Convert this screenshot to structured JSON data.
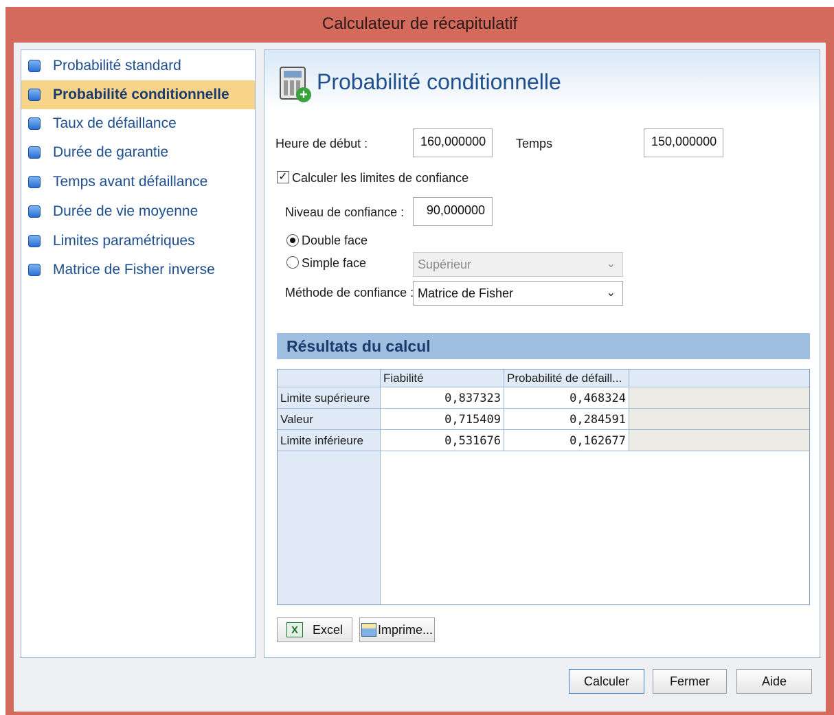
{
  "window": {
    "title": "Calculateur de récapitulatif"
  },
  "nav": {
    "items": [
      {
        "label": "Probabilité standard",
        "active": false
      },
      {
        "label": "Probabilité conditionnelle",
        "active": true
      },
      {
        "label": "Taux de défaillance",
        "active": false
      },
      {
        "label": "Durée de garantie",
        "active": false
      },
      {
        "label": "Temps avant défaillance",
        "active": false
      },
      {
        "label": "Durée de vie moyenne",
        "active": false
      },
      {
        "label": "Limites paramétriques",
        "active": false
      },
      {
        "label": "Matrice de Fisher inverse",
        "active": false
      }
    ]
  },
  "panel": {
    "title": "Probabilité conditionnelle",
    "start_time_label": "Heure de début :",
    "start_time_value": "160,000000",
    "time_label": "Temps",
    "time_value": "150,000000",
    "confidence_checkbox_label": "Calculer les limites de confiance",
    "confidence_checked": true,
    "confidence_level_label": "Niveau de confiance :",
    "confidence_level_value": "90,000000",
    "two_sided_label": "Double face",
    "one_sided_label": "Simple face",
    "one_sided_option": "Supérieur",
    "method_label": "Méthode de confiance :",
    "method_value": "Matrice de Fisher"
  },
  "results": {
    "header": "Résultats du calcul",
    "columns": [
      "Fiabilité",
      "Probabilité de défaill..."
    ],
    "rows": [
      {
        "label": "Limite supérieure",
        "values": [
          "0,837323",
          "0,468324"
        ]
      },
      {
        "label": "Valeur",
        "values": [
          "0,715409",
          "0,284591"
        ]
      },
      {
        "label": "Limite inférieure",
        "values": [
          "0,531676",
          "0,162677"
        ]
      }
    ],
    "excel_label": "Excel",
    "print_label": "Imprime..."
  },
  "footer": {
    "calculate": "Calculer",
    "close": "Fermer",
    "help": "Aide"
  },
  "colors": {
    "titlebar": "#d46a5c",
    "active_nav": "#f7d487",
    "accent_text": "#1f4f8e",
    "results_header": "#9fbfe0"
  }
}
